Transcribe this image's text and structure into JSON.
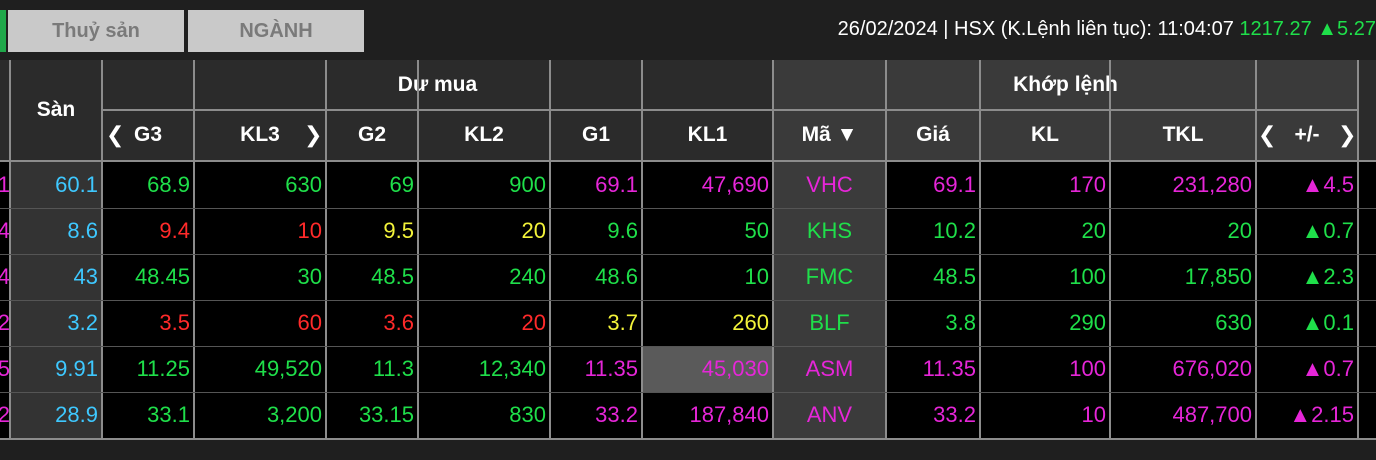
{
  "tabs": [
    {
      "label": "Thuỷ sản"
    },
    {
      "label": "NGÀNH"
    }
  ],
  "status": {
    "text": "26/02/2024 | HSX (K.Lệnh liên tục): 11:04:07",
    "index_value": "1217.27",
    "index_change": "▲5.27"
  },
  "headers": {
    "san": "Sàn",
    "du_mua": "Dư mua",
    "khop_lenh": "Khớp lệnh",
    "g3": "G3",
    "kl3": "KL3",
    "g2": "G2",
    "kl2": "KL2",
    "g1": "G1",
    "kl1": "KL1",
    "ma": "Mã ▼",
    "gia": "Giá",
    "kl": "KL",
    "tkl": "TKL",
    "change": "+/-",
    "nav_left": "❮",
    "nav_right": "❯"
  },
  "colors": {
    "green": "#1fdf4a",
    "red": "#ff2a2a",
    "yellow": "#f3f33a",
    "magenta": "#e626d8",
    "cyan": "#3ec8ff"
  },
  "rows": [
    {
      "edge": "1",
      "edge_color": "magenta",
      "san": "60.1",
      "g3": "68.9",
      "g3c": "green",
      "kl3": "630",
      "kl3c": "green",
      "g2": "69",
      "g2c": "green",
      "kl2": "900",
      "kl2c": "green",
      "g1": "69.1",
      "g1c": "magenta",
      "kl1": "47,690",
      "kl1c": "magenta",
      "ma": "VHC",
      "gia": "69.1",
      "kl": "170",
      "tkl": "231,280",
      "chg": "▲4.5",
      "mc": "magenta"
    },
    {
      "edge": "4",
      "edge_color": "magenta",
      "san": "8.6",
      "g3": "9.4",
      "g3c": "red",
      "kl3": "10",
      "kl3c": "red",
      "g2": "9.5",
      "g2c": "yellow",
      "kl2": "20",
      "kl2c": "yellow",
      "g1": "9.6",
      "g1c": "green",
      "kl1": "50",
      "kl1c": "green",
      "ma": "KHS",
      "gia": "10.2",
      "kl": "20",
      "tkl": "20",
      "chg": "▲0.7",
      "mc": "green"
    },
    {
      "edge": "4",
      "edge_color": "magenta",
      "san": "43",
      "g3": "48.45",
      "g3c": "green",
      "kl3": "30",
      "kl3c": "green",
      "g2": "48.5",
      "g2c": "green",
      "kl2": "240",
      "kl2c": "green",
      "g1": "48.6",
      "g1c": "green",
      "kl1": "10",
      "kl1c": "green",
      "ma": "FMC",
      "gia": "48.5",
      "kl": "100",
      "tkl": "17,850",
      "chg": "▲2.3",
      "mc": "green"
    },
    {
      "edge": "2",
      "edge_color": "magenta",
      "san": "3.2",
      "g3": "3.5",
      "g3c": "red",
      "kl3": "60",
      "kl3c": "red",
      "g2": "3.6",
      "g2c": "red",
      "kl2": "20",
      "kl2c": "red",
      "g1": "3.7",
      "g1c": "yellow",
      "kl1": "260",
      "kl1c": "yellow",
      "ma": "BLF",
      "gia": "3.8",
      "kl": "290",
      "tkl": "630",
      "chg": "▲0.1",
      "mc": "green"
    },
    {
      "edge": "5",
      "edge_color": "magenta",
      "san": "9.91",
      "g3": "11.25",
      "g3c": "green",
      "kl3": "49,520",
      "kl3c": "green",
      "g2": "11.3",
      "g2c": "green",
      "kl2": "12,340",
      "kl2c": "green",
      "g1": "11.35",
      "g1c": "magenta",
      "kl1": "45,030",
      "kl1c": "magenta",
      "ma": "ASM",
      "gia": "11.35",
      "kl": "100",
      "tkl": "676,020",
      "chg": "▲0.7",
      "mc": "magenta"
    },
    {
      "edge": "2",
      "edge_color": "magenta",
      "san": "28.9",
      "g3": "33.1",
      "g3c": "green",
      "kl3": "3,200",
      "kl3c": "green",
      "g2": "33.15",
      "g2c": "green",
      "kl2": "830",
      "kl2c": "green",
      "g1": "33.2",
      "g1c": "magenta",
      "kl1": "187,840",
      "kl1c": "magenta",
      "ma": "ANV",
      "gia": "33.2",
      "kl": "10",
      "tkl": "487,700",
      "chg": "▲2.15",
      "mc": "magenta"
    }
  ]
}
